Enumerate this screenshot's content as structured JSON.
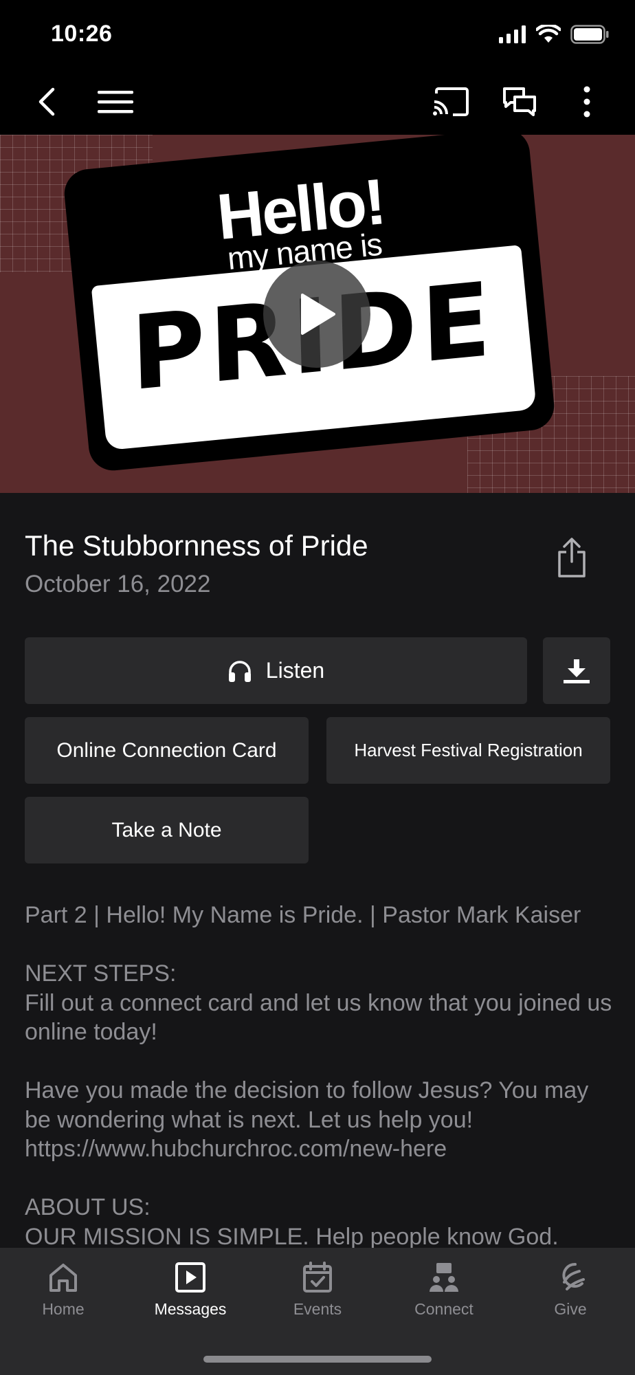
{
  "status": {
    "time": "10:26"
  },
  "nav": {
    "back_icon": "chevron-left-icon",
    "menu_icon": "hamburger-icon",
    "cast_icon": "cast-icon",
    "chat_icon": "chat-bubbles-icon",
    "more_icon": "more-vertical-icon"
  },
  "hero": {
    "hello": "Hello!",
    "my_name_is": "my name is",
    "name": "PRIDE",
    "background_color": "#5a2b2c"
  },
  "message": {
    "title": "The Stubbornness of Pride",
    "date": "October 16, 2022"
  },
  "actions": {
    "listen_label": "Listen",
    "connection_card_label": "Online Connection Card",
    "harvest_label": "Harvest Festival Registration",
    "note_label": "Take a Note"
  },
  "description": {
    "line1": "Part 2 | Hello! My Name is Pride. | Pastor Mark Kaiser",
    "next_steps_heading": "NEXT STEPS:",
    "next_steps_text": "Fill out a connect card and let us know that you joined us online today!",
    "decision_text": "Have you made the decision to follow Jesus? You may be wondering what is next. Let us help you!",
    "link": "https://www.hubchurchroc.com/new-here",
    "about_heading": "ABOUT US:",
    "mission_text": "OUR MISSION IS SIMPLE. Help people know God."
  },
  "tabs": [
    {
      "label": "Home",
      "icon": "home-icon",
      "active": false
    },
    {
      "label": "Messages",
      "icon": "play-square-icon",
      "active": true
    },
    {
      "label": "Events",
      "icon": "calendar-icon",
      "active": false
    },
    {
      "label": "Connect",
      "icon": "people-icon",
      "active": false
    },
    {
      "label": "Give",
      "icon": "give-icon",
      "active": false
    }
  ]
}
